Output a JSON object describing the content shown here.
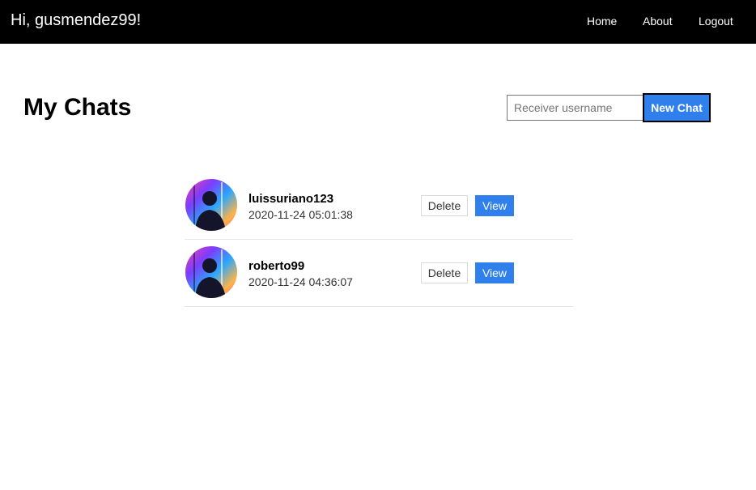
{
  "navbar": {
    "greeting": "Hi, gusmendez99!",
    "links": [
      {
        "label": "Home"
      },
      {
        "label": "About"
      },
      {
        "label": "Logout"
      }
    ]
  },
  "main": {
    "title": "My Chats",
    "receiver_placeholder": "Receiver username",
    "receiver_value": "",
    "new_chat_label": "New Chat"
  },
  "chats": [
    {
      "username": "luissuriano123",
      "timestamp": "2020-11-24 05:01:38",
      "delete_label": "Delete",
      "view_label": "View",
      "avatar_icon": "user-avatar-icon"
    },
    {
      "username": "roberto99",
      "timestamp": "2020-11-24 04:36:07",
      "delete_label": "Delete",
      "view_label": "View",
      "avatar_icon": "user-avatar-icon"
    }
  ],
  "colors": {
    "navbar_bg": "#000000",
    "accent": "#2f80ed",
    "divider": "#e6e6e6"
  }
}
